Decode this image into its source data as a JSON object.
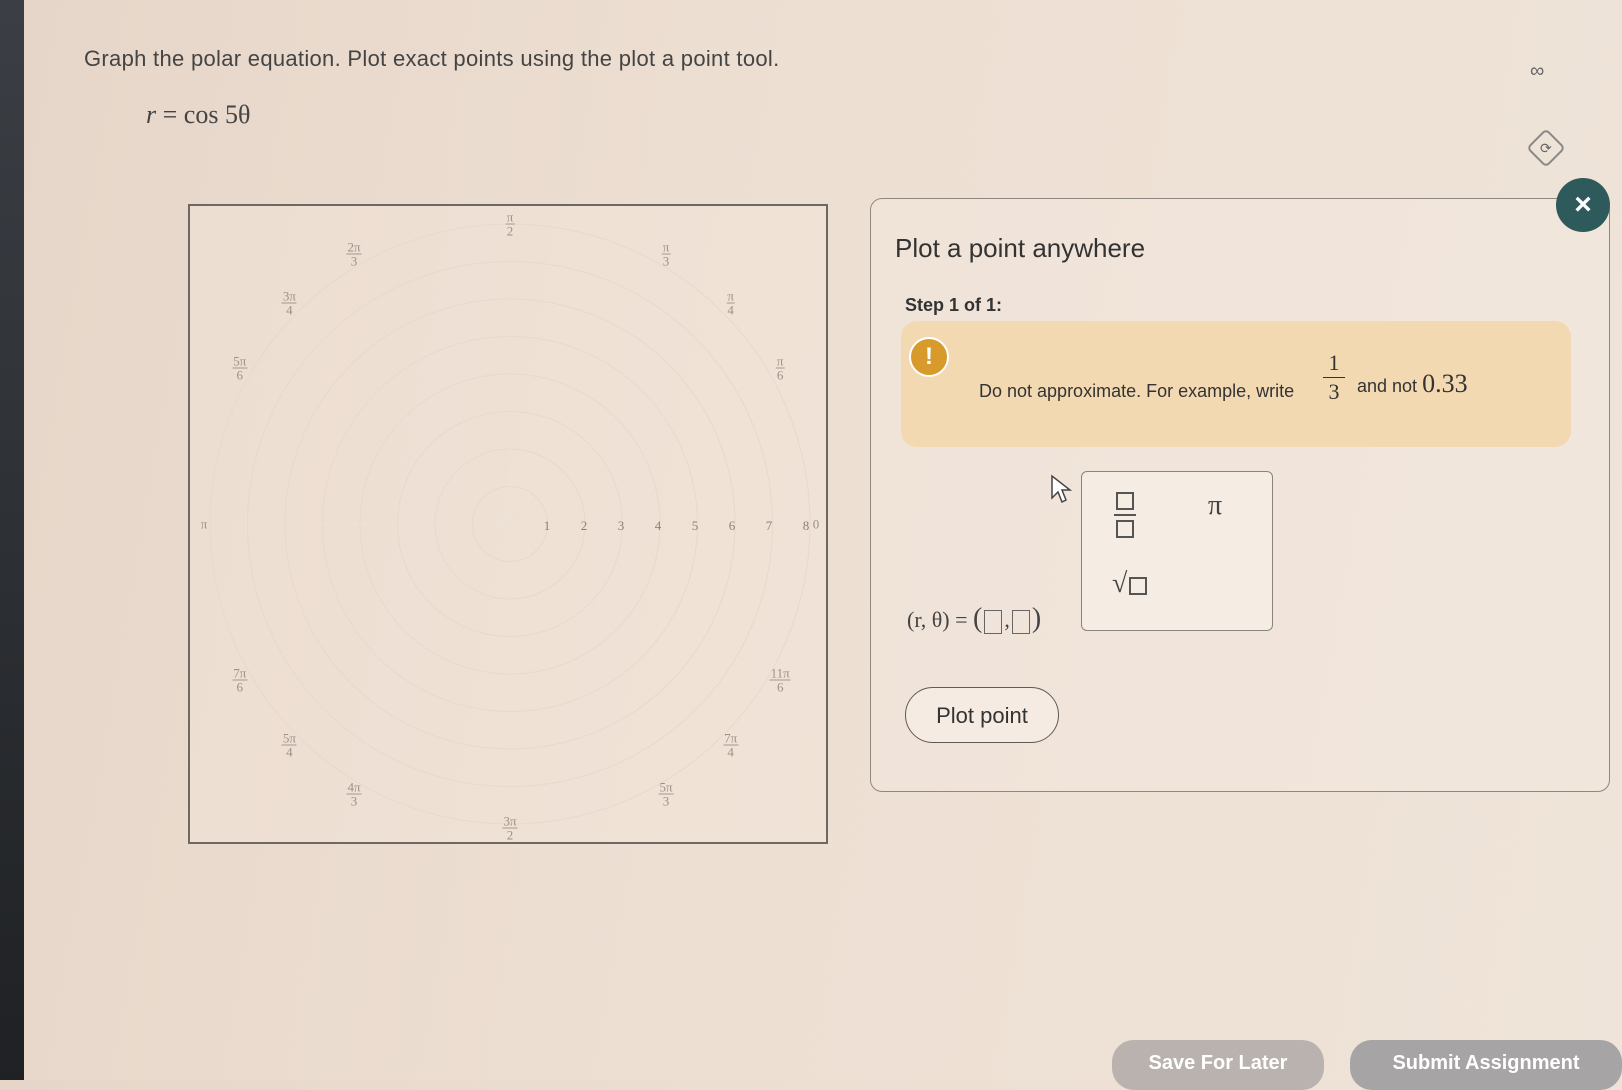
{
  "question": {
    "instruction": "Graph the polar equation. Plot exact points using the plot a point tool.",
    "equation_lhs": "r",
    "equation_rhs": " = cos 5θ"
  },
  "top_icons": {
    "glasses": "∞",
    "refresh": "⟳"
  },
  "graph": {
    "angle_labels": [
      {
        "num": "π",
        "den": "2"
      },
      {
        "num": "π",
        "den": "3"
      },
      {
        "num": "π",
        "den": "4"
      },
      {
        "num": "π",
        "den": "6"
      },
      {
        "num": "0",
        "den": ""
      },
      {
        "num": "11π",
        "den": "6"
      },
      {
        "num": "7π",
        "den": "4"
      },
      {
        "num": "5π",
        "den": "3"
      },
      {
        "num": "3π",
        "den": "2"
      },
      {
        "num": "4π",
        "den": "3"
      },
      {
        "num": "5π",
        "den": "4"
      },
      {
        "num": "7π",
        "den": "6"
      },
      {
        "num": "π",
        "den": ""
      },
      {
        "num": "5π",
        "den": "6"
      },
      {
        "num": "3π",
        "den": "4"
      },
      {
        "num": "2π",
        "den": "3"
      }
    ],
    "radial_labels": [
      "1",
      "2",
      "3",
      "4",
      "5",
      "6",
      "7",
      "8"
    ]
  },
  "panel": {
    "title": "Plot a point anywhere",
    "step": "Step 1 of 1:",
    "warning_icon": "!",
    "warning_text": "Do not approximate. For example, write",
    "warning_frac_num": "1",
    "warning_frac_den": "3",
    "warning_tail": "and not",
    "warning_value": "0.33",
    "rtheta_label": "(r, θ) =",
    "keypad": {
      "pi": "π",
      "sqrt": "√"
    },
    "plot_button": "Plot point"
  },
  "close_label": "×",
  "footer": {
    "save": "Save For Later",
    "submit": "Submit Assignment"
  }
}
